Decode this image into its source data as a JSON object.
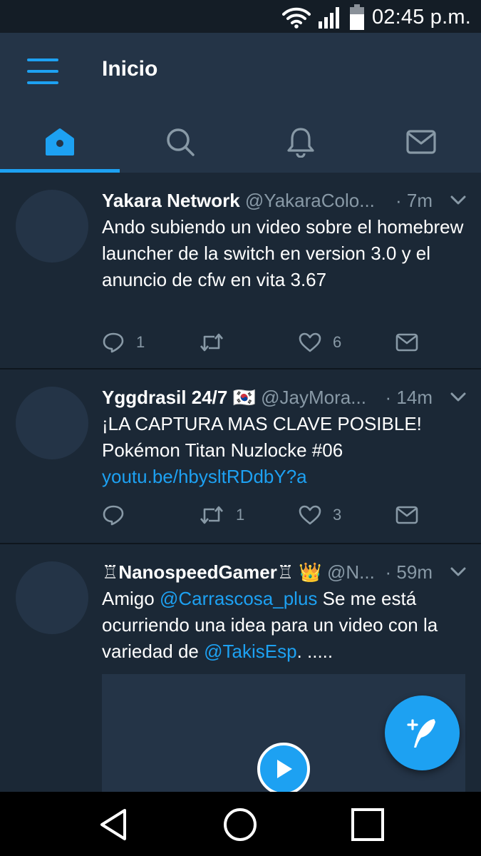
{
  "status_bar": {
    "time": "02:45 p.m.",
    "icons": [
      "wifi-icon",
      "signal-icon",
      "battery-icon"
    ]
  },
  "header": {
    "title": "Inicio",
    "menu_icon": "hamburger-menu-icon"
  },
  "tabs": [
    {
      "name": "home",
      "icon": "home-icon",
      "active": true
    },
    {
      "name": "search",
      "icon": "search-icon",
      "active": false
    },
    {
      "name": "notifications",
      "icon": "bell-icon",
      "active": false
    },
    {
      "name": "messages",
      "icon": "mail-icon",
      "active": false
    }
  ],
  "tweets": [
    {
      "name": "Yakara Network",
      "handle": "@YakaraColo...",
      "time": "· 7m",
      "text": "Ando subiendo un video sobre el homebrew launcher de la switch en version 3.0 y el anuncio de cfw en vita 3.67",
      "replies": "1",
      "retweets": "",
      "likes": "6"
    },
    {
      "name": "Yggdrasil 24/7",
      "flag": "🇰🇷",
      "handle": "@JayMora...",
      "time": "· 14m",
      "text_1": "¡LA CAPTURA MAS CLAVE POSIBLE! Pokémon Titan Nuzlocke #06",
      "link": "youtu.be/hbysltRDdbY?a",
      "replies": "",
      "retweets": "1",
      "likes": "3"
    },
    {
      "name_prefix": "♖",
      "name": "NanospeedGamer",
      "name_suffix": "♖",
      "crown": "👑",
      "handle": "@N...",
      "time": "· 59m",
      "text_1": "Amigo",
      "mention_1": "@Carrascosa_plus",
      "text_2": "Se me está ocurriendo una idea para un video con la variedad de",
      "mention_2": "@TakisEsp",
      "text_3": ". ....."
    }
  ],
  "colors": {
    "accent": "#1da1f2",
    "background": "#1b2836",
    "header": "#243447",
    "secondary_text": "#8899a6"
  }
}
